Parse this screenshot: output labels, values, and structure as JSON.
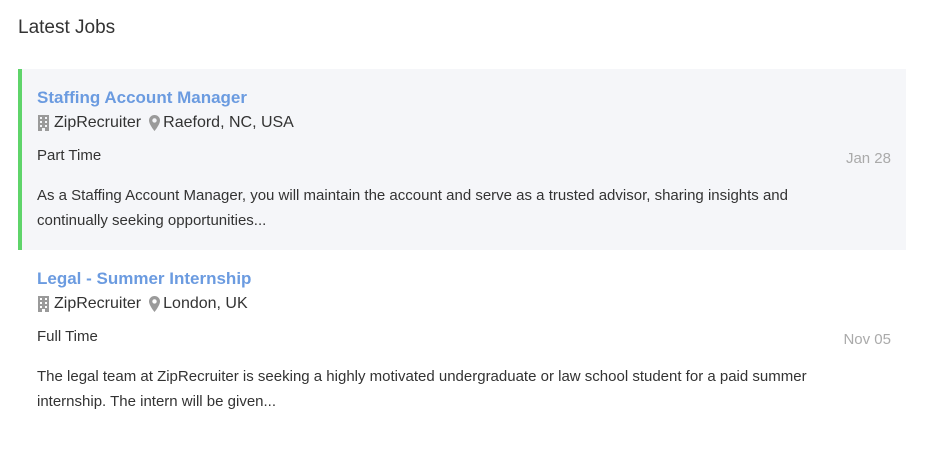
{
  "section": {
    "title": "Latest Jobs"
  },
  "jobs": [
    {
      "title": "Staffing Account Manager",
      "company": "ZipRecruiter",
      "location": "Raeford, NC, USA",
      "type": "Part Time",
      "date": "Jan 28",
      "description": "As a Staffing Account Manager, you will maintain the account and serve as a trusted advisor, sharing insights and continually seeking opportunities..."
    },
    {
      "title": "Legal - Summer Internship",
      "company": "ZipRecruiter",
      "location": "London, UK",
      "type": "Full Time",
      "date": "Nov 05",
      "description": "The legal team at ZipRecruiter is seeking a highly motivated undergraduate or law school student for a paid summer internship. The intern will be given..."
    }
  ],
  "icons": {
    "company": "building-icon",
    "location": "map-pin-icon"
  },
  "colors": {
    "title_link": "#6b9be0",
    "active_border": "#5fd46a",
    "active_bg": "#f5f6f9",
    "date_text": "#aaaaaa"
  }
}
